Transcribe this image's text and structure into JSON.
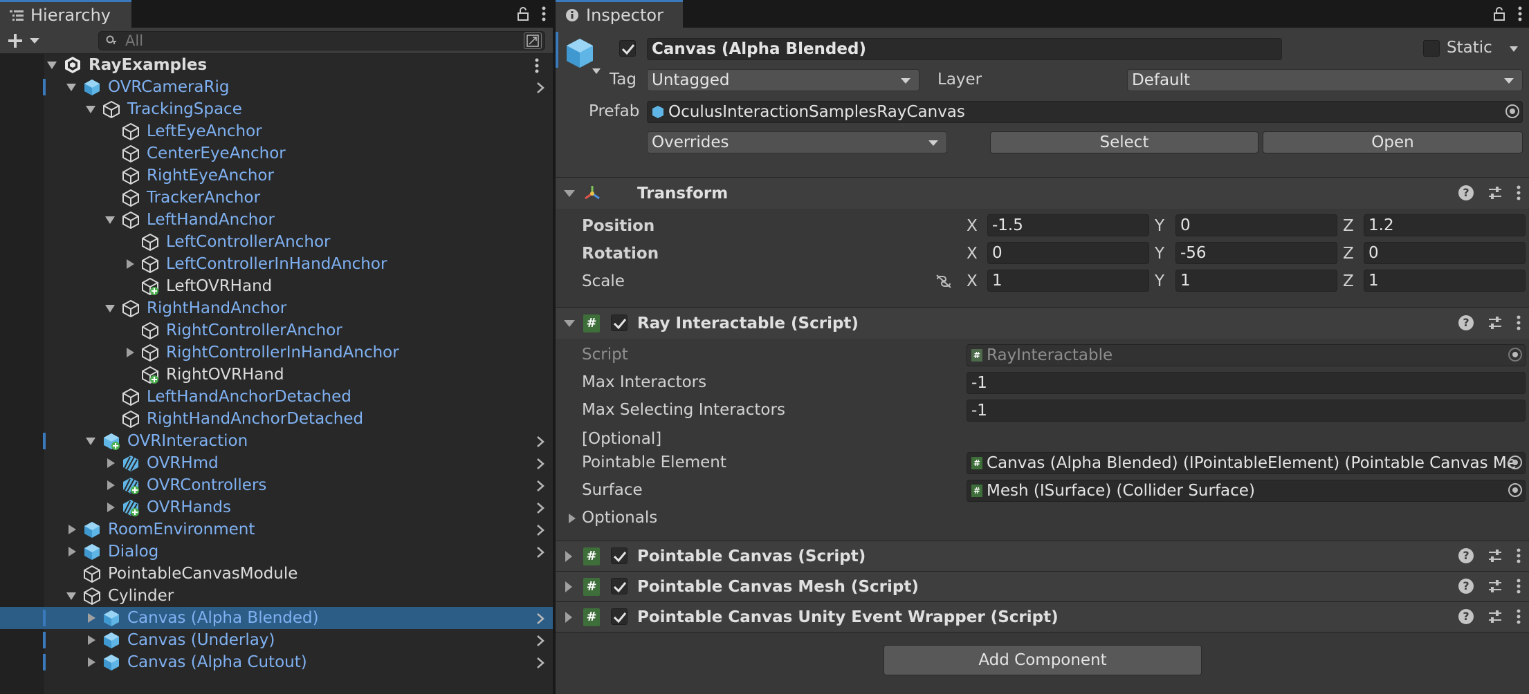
{
  "hierarchy": {
    "tab_label": "Hierarchy",
    "search_placeholder": "All",
    "root": "RayExamples",
    "items": [
      {
        "label": "OVRCameraRig",
        "depth": 1,
        "expanded": true,
        "icon": "prefab-cube-icon",
        "prefab": true,
        "chevron": true,
        "mark": true
      },
      {
        "label": "TrackingSpace",
        "depth": 2,
        "expanded": true,
        "icon": "gameobject-cube-icon",
        "prefab": true
      },
      {
        "label": "LeftEyeAnchor",
        "depth": 3,
        "icon": "gameobject-cube-icon",
        "prefab": true
      },
      {
        "label": "CenterEyeAnchor",
        "depth": 3,
        "icon": "gameobject-cube-icon",
        "prefab": true
      },
      {
        "label": "RightEyeAnchor",
        "depth": 3,
        "icon": "gameobject-cube-icon",
        "prefab": true
      },
      {
        "label": "TrackerAnchor",
        "depth": 3,
        "icon": "gameobject-cube-icon",
        "prefab": true
      },
      {
        "label": "LeftHandAnchor",
        "depth": 3,
        "expanded": true,
        "icon": "gameobject-cube-icon",
        "prefab": true
      },
      {
        "label": "LeftControllerAnchor",
        "depth": 4,
        "icon": "gameobject-cube-icon",
        "prefab": true
      },
      {
        "label": "LeftControllerInHandAnchor",
        "depth": 4,
        "collapsed": true,
        "icon": "gameobject-cube-icon",
        "prefab": true
      },
      {
        "label": "LeftOVRHand",
        "depth": 4,
        "icon": "added-gameobject-icon",
        "prefab": false
      },
      {
        "label": "RightHandAnchor",
        "depth": 3,
        "expanded": true,
        "icon": "gameobject-cube-icon",
        "prefab": true
      },
      {
        "label": "RightControllerAnchor",
        "depth": 4,
        "icon": "gameobject-cube-icon",
        "prefab": true
      },
      {
        "label": "RightControllerInHandAnchor",
        "depth": 4,
        "collapsed": true,
        "icon": "gameobject-cube-icon",
        "prefab": true
      },
      {
        "label": "RightOVRHand",
        "depth": 4,
        "icon": "added-gameobject-icon",
        "prefab": false
      },
      {
        "label": "LeftHandAnchorDetached",
        "depth": 3,
        "icon": "gameobject-cube-icon",
        "prefab": true
      },
      {
        "label": "RightHandAnchorDetached",
        "depth": 3,
        "icon": "gameobject-cube-icon",
        "prefab": true
      },
      {
        "label": "OVRInteraction",
        "depth": 2,
        "expanded": true,
        "icon": "added-prefab-icon",
        "prefab": true,
        "chevron": true,
        "mark": true
      },
      {
        "label": "OVRHmd",
        "depth": 3,
        "collapsed": true,
        "icon": "prefab-variant-icon",
        "prefab": true,
        "chevron": true
      },
      {
        "label": "OVRControllers",
        "depth": 3,
        "collapsed": true,
        "icon": "added-prefab-variant-icon",
        "prefab": true,
        "chevron": true
      },
      {
        "label": "OVRHands",
        "depth": 3,
        "collapsed": true,
        "icon": "added-prefab-variant-icon",
        "prefab": true,
        "chevron": true
      },
      {
        "label": "RoomEnvironment",
        "depth": 1,
        "collapsed": true,
        "icon": "prefab-cube-icon",
        "prefab": true,
        "chevron": true
      },
      {
        "label": "Dialog",
        "depth": 1,
        "collapsed": true,
        "icon": "prefab-cube-icon",
        "prefab": true,
        "chevron": true
      },
      {
        "label": "PointableCanvasModule",
        "depth": 1,
        "icon": "gameobject-cube-icon",
        "prefab": false
      },
      {
        "label": "Cylinder",
        "depth": 1,
        "expanded": true,
        "icon": "gameobject-cube-icon",
        "prefab": false
      },
      {
        "label": "Canvas (Alpha Blended)",
        "depth": 2,
        "collapsed": true,
        "icon": "prefab-cube-icon",
        "prefab": true,
        "chevron": true,
        "mark": true,
        "selected": true
      },
      {
        "label": "Canvas (Underlay)",
        "depth": 2,
        "collapsed": true,
        "icon": "prefab-cube-icon",
        "prefab": true,
        "chevron": true,
        "mark": true
      },
      {
        "label": "Canvas (Alpha Cutout)",
        "depth": 2,
        "collapsed": true,
        "icon": "prefab-cube-icon",
        "prefab": true,
        "chevron": true,
        "mark": true
      }
    ]
  },
  "inspector": {
    "tab_label": "Inspector",
    "object_name": "Canvas (Alpha Blended)",
    "active": true,
    "static_label": "Static",
    "tag_label": "Tag",
    "tag_value": "Untagged",
    "layer_label": "Layer",
    "layer_value": "Default",
    "prefab_label": "Prefab",
    "prefab_value": "OculusInteractionSamplesRayCanvas",
    "overrides_label": "Overrides",
    "select_label": "Select",
    "open_label": "Open",
    "transform": {
      "title": "Transform",
      "position_label": "Position",
      "rotation_label": "Rotation",
      "scale_label": "Scale",
      "position": {
        "x": "-1.5",
        "y": "0",
        "z": "1.2"
      },
      "rotation": {
        "x": "0",
        "y": "-56",
        "z": "0"
      },
      "scale": {
        "x": "1",
        "y": "1",
        "z": "1"
      },
      "axis_x": "X",
      "axis_y": "Y",
      "axis_z": "Z"
    },
    "ray_interactable": {
      "title": "Ray Interactable (Script)",
      "script_label": "Script",
      "script_value": "RayInteractable",
      "max_interactors_label": "Max Interactors",
      "max_interactors_value": "-1",
      "max_selecting_label": "Max Selecting Interactors",
      "max_selecting_value": "-1",
      "optional_header": "[Optional]",
      "pointable_label": "Pointable Element",
      "pointable_value": "Canvas (Alpha Blended) (IPointableElement) (Pointable Canvas Me",
      "surface_label": "Surface",
      "surface_value": "Mesh (ISurface) (Collider Surface)",
      "optionals_label": "Optionals"
    },
    "components": [
      {
        "title": "Pointable Canvas (Script)"
      },
      {
        "title": "Pointable Canvas Mesh (Script)"
      },
      {
        "title": "Pointable Canvas Unity Event Wrapper (Script)"
      }
    ],
    "add_component_label": "Add Component"
  }
}
